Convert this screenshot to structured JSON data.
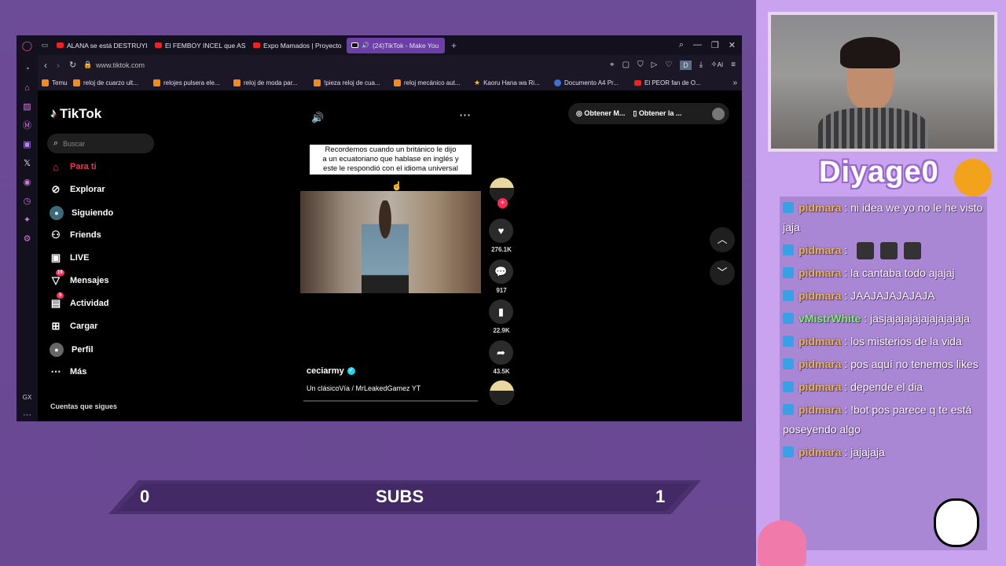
{
  "browser": {
    "tabs": [
      {
        "label": "ALANA se está DESTRUYI",
        "kind": "yt"
      },
      {
        "label": "El FEMBOY INCEL que AS",
        "kind": "yt"
      },
      {
        "label": "Expo Mamados | Proyecto",
        "kind": "yt"
      },
      {
        "label": "(24)TikTok - Make You",
        "kind": "tt"
      }
    ],
    "new_tab": "+",
    "url": "www.tiktok.com",
    "profile_letter": "D",
    "ai_label": "AI",
    "bookmarks": [
      "Temu",
      "reloj de cuarzo ult...",
      "relojes pulsera ele...",
      "reloj de moda par...",
      "!pieza reloj de cua...",
      "reloj mecánico aut...",
      "Kaoru Hana wa Ri...",
      "Documento A4 Pr...",
      "El PEOR fan de O..."
    ],
    "gx_label": "GX"
  },
  "tiktok": {
    "logo": "TikTok",
    "search_placeholder": "Buscar",
    "nav": [
      {
        "label": "Para ti",
        "icon": "home-icon",
        "active": true
      },
      {
        "label": "Explorar",
        "icon": "compass-icon"
      },
      {
        "label": "Siguiendo",
        "icon": "following-avatar-icon"
      },
      {
        "label": "Friends",
        "icon": "friends-icon"
      },
      {
        "label": "LIVE",
        "icon": "live-icon"
      },
      {
        "label": "Mensajes",
        "icon": "messages-icon",
        "badge": "19"
      },
      {
        "label": "Actividad",
        "icon": "activity-icon",
        "badge": "5"
      },
      {
        "label": "Cargar",
        "icon": "upload-icon"
      },
      {
        "label": "Perfil",
        "icon": "profile-icon"
      },
      {
        "label": "Más",
        "icon": "more-icon"
      }
    ],
    "following_heading": "Cuentas que sigues",
    "top_buttons": {
      "get_coins": "Obtener M...",
      "get_app": "Obtener la ..."
    },
    "video": {
      "caption_lines": [
        "Recordemos cuando un británico le dijo",
        "a un ecuatoriano que hablase en inglés y",
        "este le respondió con el idioma universal"
      ],
      "author": "ceciarmy",
      "description": "Un clásicoVía / MrLeakedGamez YT"
    },
    "actions": {
      "likes": "276.1K",
      "comments": "917",
      "saves": "22.9K",
      "shares": "43.5K"
    }
  },
  "overlay": {
    "subs_left": "0",
    "subs_title": "SUBS",
    "subs_right": "1",
    "streamer_name": "Diyage0"
  },
  "chat": [
    {
      "user": "pidmara",
      "text": ": ni idea we yo no le he visto jaja"
    },
    {
      "user": "pidmara",
      "text": ":",
      "emotes": 3
    },
    {
      "user": "pidmara",
      "text": ": la cantaba todo ajajaj"
    },
    {
      "user": "pidmara",
      "text": ": JAAJAJAJAJAJA"
    },
    {
      "user": "vMistrWhite",
      "text": ": jasjajajajajajajajajaja",
      "green": true
    },
    {
      "user": "pidmara",
      "text": ": los misterios de la vida"
    },
    {
      "user": "pidmara",
      "text": ": pos aquí no tenemos likes"
    },
    {
      "user": "pidmara",
      "text": ": depende el dia"
    },
    {
      "user": "pidmara",
      "text": ": !bot pos parece q te está poseyendo algo"
    },
    {
      "user": "pidmara",
      "text": ": jajajaja"
    }
  ],
  "colors": {
    "accent_pink": "#fe2c55",
    "opera_purple": "#6b3ea8",
    "chat_name": "#e4b64a"
  }
}
